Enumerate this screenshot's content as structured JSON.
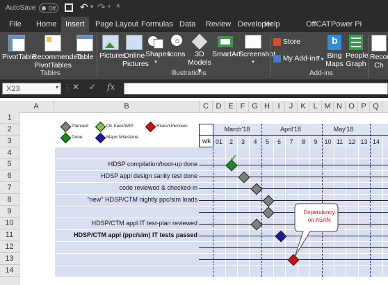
{
  "titlebar": {
    "autosave_label": "AutoSave",
    "autosave_state": "Off"
  },
  "ribbon_tabs": [
    "File",
    "Home",
    "Insert",
    "Page Layout",
    "Formulas",
    "Data",
    "Review",
    "Developer",
    "Help",
    "OffCAT",
    "Power Pi"
  ],
  "active_tab": "Insert",
  "ribbon": {
    "pivottable": "PivotTable",
    "recommended_pivottables_1": "Recommended",
    "recommended_pivottables_2": "PivotTables",
    "table": "Table",
    "tables_group": "Tables",
    "pictures": "Pictures",
    "online_pictures_1": "Online",
    "online_pictures_2": "Pictures",
    "shapes": "Shapes",
    "icons": "Icons",
    "models_1": "3D",
    "models_2": "Models",
    "smartart": "SmartArt",
    "screenshot": "Screenshot",
    "illustrations_group": "Illustrations",
    "store": "Store",
    "my_addins": "My Add-ins",
    "bing_maps_1": "Bing",
    "bing_maps_2": "Maps",
    "people_graph_1": "People",
    "people_graph_2": "Graph",
    "addins_group": "Add-ins",
    "recommended_charts_1": "Recom",
    "recommended_charts_2": "Ch"
  },
  "formula_bar": {
    "namebox": "X23",
    "fx": "fx",
    "content": ""
  },
  "columns": [
    "A",
    "B",
    "C",
    "D",
    "E",
    "F",
    "G",
    "H",
    "I",
    "J",
    "K",
    "L",
    "M",
    "N",
    "O",
    "P",
    "Q"
  ],
  "rows": [
    "1",
    "2",
    "3",
    "4",
    "5",
    "6",
    "7",
    "8",
    "9",
    "10",
    "11",
    "12",
    "13",
    "14"
  ],
  "legend": {
    "planned": "Planned",
    "on_track": "On track/WIP",
    "risks": "Risks/Unknown",
    "done": "Done",
    "major": "Major Milestone"
  },
  "header": {
    "months": [
      "March'18",
      "April'18",
      "May'18"
    ],
    "wk": "wk",
    "weeks": [
      "01",
      "2",
      "3",
      "4",
      "5",
      "6",
      "7",
      "8",
      "9",
      "10",
      "11",
      "12",
      "13",
      "14"
    ]
  },
  "tasks": [
    "HDSP compilation/boot-up done",
    "HDSP appl design sanity test done",
    "code reviewed & checked-in",
    "\"new\" HDSP/CTM nightly ppc/sim loads",
    "",
    "HDSP/CTM appl IT test-plan reviewed",
    "HDSP/CTM appl (ppc/sim) IT tests passed",
    "",
    "",
    ""
  ],
  "callout": {
    "line1": "Dependency",
    "line2": "on ASAN"
  },
  "colors": {
    "planned": "#808080",
    "on_track": "#4aa02c",
    "risks": "#cc1111",
    "major": "#1a1aa0",
    "band": "#d9dff0"
  }
}
